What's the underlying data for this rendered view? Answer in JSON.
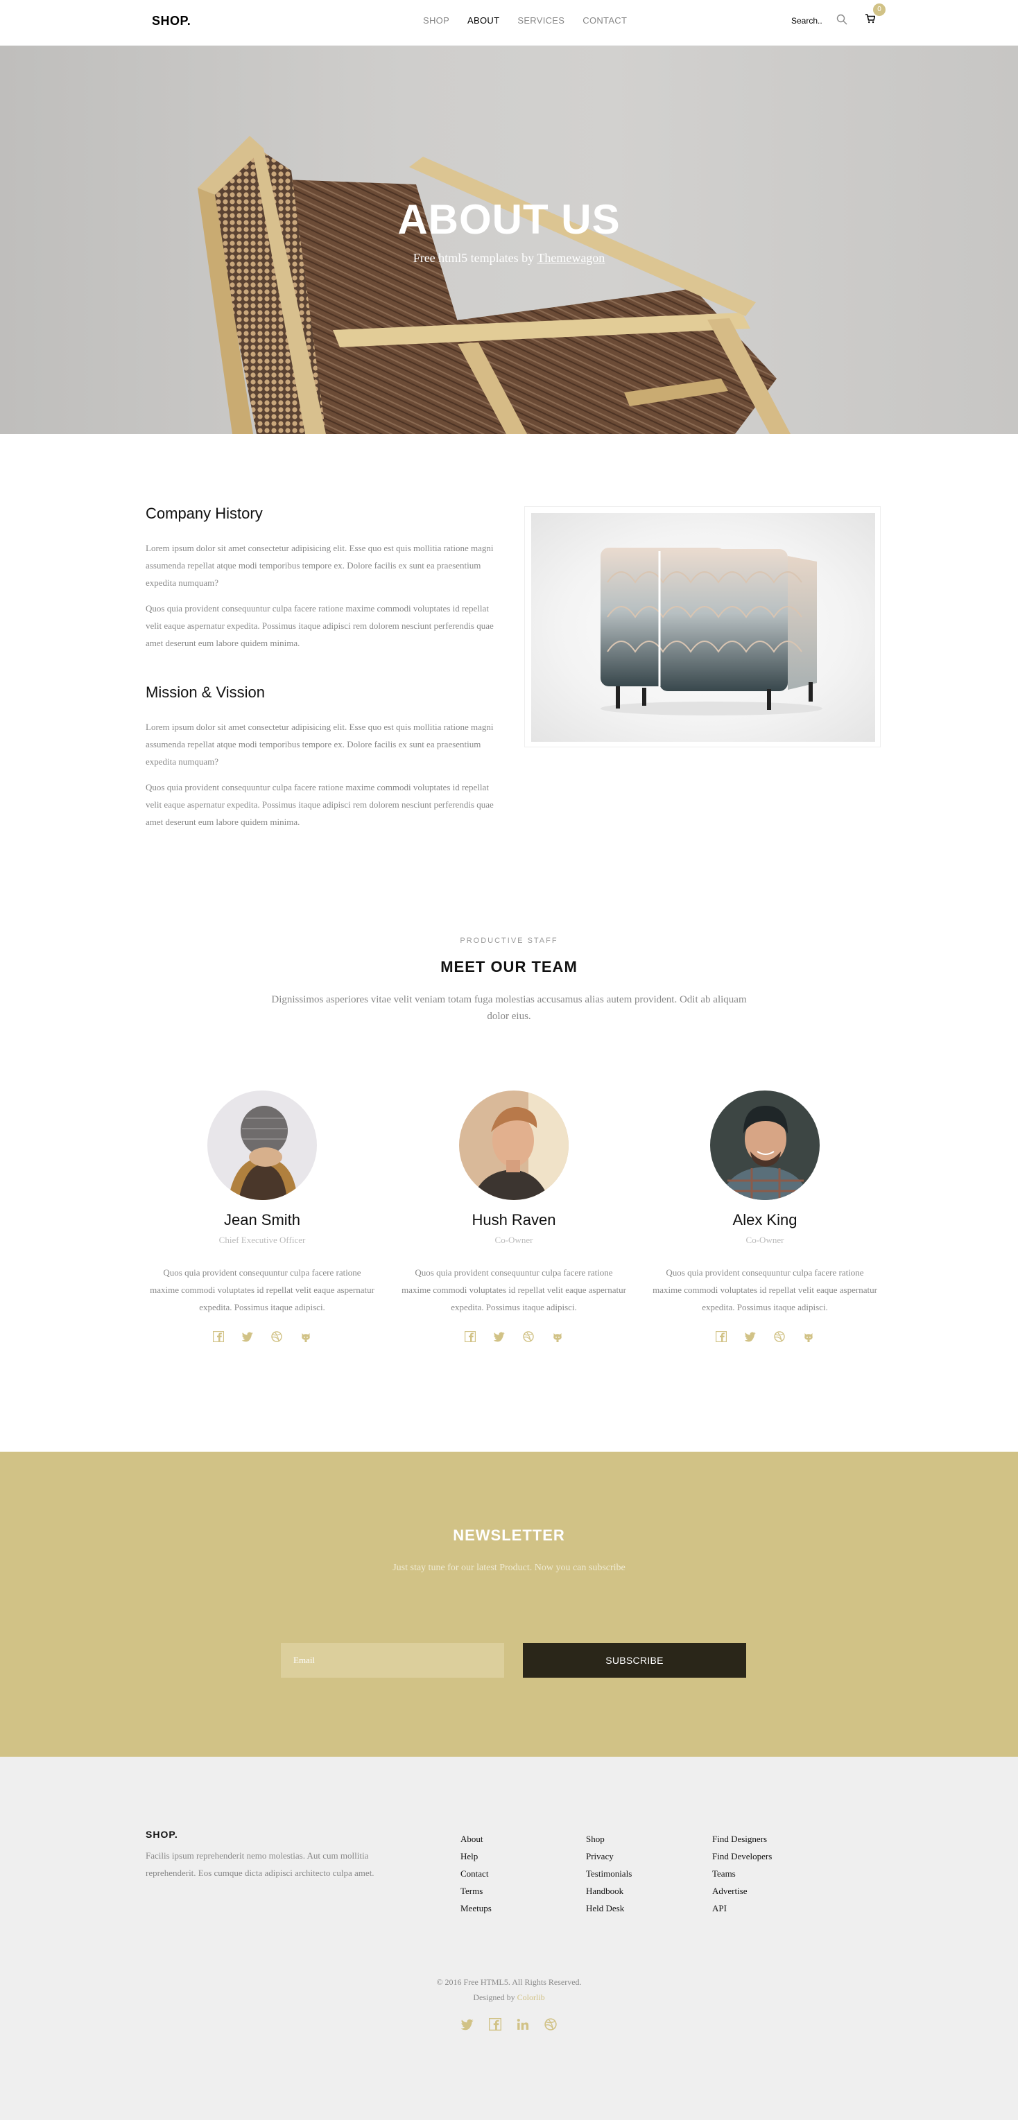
{
  "nav": {
    "logo": "SHOP.",
    "items": [
      {
        "label": "SHOP",
        "active": false
      },
      {
        "label": "ABOUT",
        "active": true
      },
      {
        "label": "SERVICES",
        "active": false
      },
      {
        "label": "CONTACT",
        "active": false
      }
    ],
    "search_placeholder": "Search..",
    "cart_count": "0",
    "icons": [
      "search-icon",
      "cart-icon"
    ]
  },
  "hero": {
    "title": "ABOUT US",
    "subtitle_prefix": "Free html5 templates by",
    "subtitle_link": "Themewagon"
  },
  "about": {
    "history_title": "Company History",
    "history_p1": "Lorem ipsum dolor sit amet consectetur adipisicing elit. Esse quo est quis mollitia ratione magni assumenda repellat atque modi temporibus tempore ex. Dolore facilis ex sunt ea praesentium expedita numquam?",
    "history_p2": "Quos quia provident consequuntur culpa facere ratione maxime commodi voluptates id repellat velit eaque aspernatur expedita. Possimus itaque adipisci rem dolorem nesciunt perferendis quae amet deserunt eum labore quidem minima.",
    "mission_title": "Mission & Vission",
    "mission_p1": "Lorem ipsum dolor sit amet consectetur adipisicing elit. Esse quo est quis mollitia ratione magni assumenda repellat atque modi temporibus tempore ex. Dolore facilis ex sunt ea praesentium expedita numquam?",
    "mission_p2": "Quos quia provident consequuntur culpa facere ratione maxime commodi voluptates id repellat velit eaque aspernatur expedita. Possimus itaque adipisci rem dolorem nesciunt perferendis quae amet deserunt eum labore quidem minima."
  },
  "team": {
    "tag": "PRODUCTIVE STAFF",
    "title": "MEET OUR TEAM",
    "intro": "Dignissimos asperiores vitae velit veniam totam fuga molestias accusamus alias autem provident. Odit ab aliquam dolor eius.",
    "members": [
      {
        "name": "Jean Smith",
        "role": "Chief Executive Officer",
        "bio": "Quos quia provident consequuntur culpa facere ratione maxime commodi voluptates id repellat velit eaque aspernatur expedita. Possimus itaque adipisci."
      },
      {
        "name": "Hush Raven",
        "role": "Co-Owner",
        "bio": "Quos quia provident consequuntur culpa facere ratione maxime commodi voluptates id repellat velit eaque aspernatur expedita. Possimus itaque adipisci."
      },
      {
        "name": "Alex King",
        "role": "Co-Owner",
        "bio": "Quos quia provident consequuntur culpa facere ratione maxime commodi voluptates id repellat velit eaque aspernatur expedita. Possimus itaque adipisci."
      }
    ],
    "social_icons": [
      "facebook-icon",
      "twitter-icon",
      "dribbble-icon",
      "github-icon"
    ]
  },
  "newsletter": {
    "title": "NEWSLETTER",
    "subtitle": "Just stay tune for our latest Product. Now you can subscribe",
    "email_placeholder": "Email",
    "button": "SUBSCRIBE"
  },
  "footer": {
    "logo": "SHOP.",
    "about": "Facilis ipsum reprehenderit nemo molestias. Aut cum mollitia reprehenderit. Eos cumque dicta adipisci architecto culpa amet.",
    "col1": [
      "About",
      "Help",
      "Contact",
      "Terms",
      "Meetups"
    ],
    "col2": [
      "Shop",
      "Privacy",
      "Testimonials",
      "Handbook",
      "Held Desk"
    ],
    "col3": [
      "Find Designers",
      "Find Developers",
      "Teams",
      "Advertise",
      "API"
    ],
    "copyright": "© 2016 Free HTML5. All Rights Reserved.",
    "designed_by_prefix": "Designed by",
    "designed_by_brand": "Colorlib",
    "social_icons": [
      "twitter-icon",
      "facebook-icon",
      "linkedin-icon",
      "dribbble-icon"
    ]
  },
  "colors": {
    "accent": "#d1c286",
    "dark_button": "#2a2619",
    "footer_bg": "#efefef"
  }
}
